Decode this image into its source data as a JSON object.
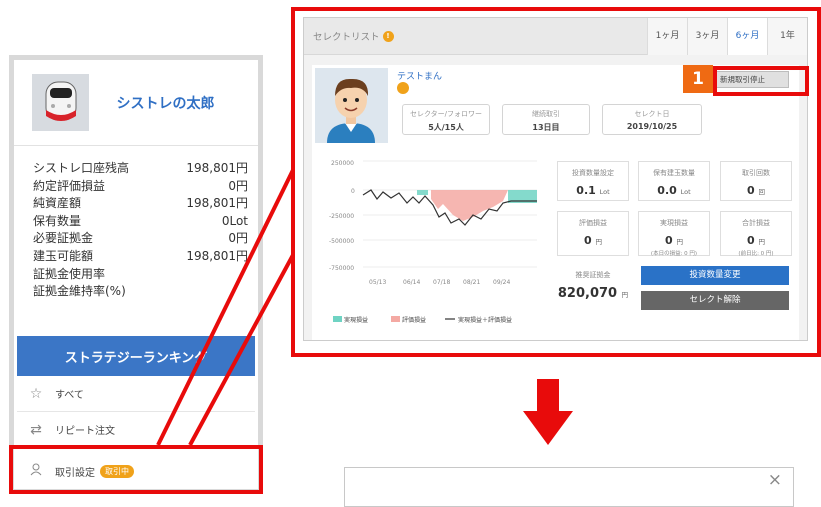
{
  "sidebar": {
    "username": "シストレの太郎",
    "stats": [
      {
        "label": "シストレ口座残高",
        "value": "198,801円"
      },
      {
        "label": "約定評価損益",
        "value": "0円"
      },
      {
        "label": "純資産額",
        "value": "198,801円"
      },
      {
        "label": "保有数量",
        "value": "0Lot"
      },
      {
        "label": "必要証拠金",
        "value": "0円"
      },
      {
        "label": "建玉可能額",
        "value": "198,801円"
      },
      {
        "label": "証拠金使用率",
        "value": ""
      },
      {
        "label": "証拠金維持率(%)",
        "value": ""
      }
    ],
    "ranking_label": "ストラテジーランキング",
    "menu": [
      {
        "label": "すべて",
        "icon": "star-icon"
      },
      {
        "label": "リピート注文",
        "icon": "repeat-icon"
      },
      {
        "label": "取引設定",
        "icon": "user-icon",
        "badge": "取引中"
      }
    ]
  },
  "panel": {
    "title": "セレクトリスト",
    "info_mark": "!",
    "periods": [
      "1ヶ月",
      "3ヶ月",
      "6ヶ月",
      "1年"
    ],
    "active_period": "6ヶ月",
    "trader_name": "テストまん",
    "info_boxes": [
      {
        "label": "セレクター/フォロワー",
        "value": "5人/15人"
      },
      {
        "label": "継続取引",
        "value": "13日目"
      },
      {
        "label": "セレクト日",
        "value": "2019/10/25"
      }
    ],
    "stop_button": "新規取引停止",
    "step_number": "1",
    "metrics": {
      "lot_setting": {
        "label": "投資数量設定",
        "value": "0.1",
        "unit": "Lot"
      },
      "position_qty": {
        "label": "保有建玉数量",
        "value": "0.0",
        "unit": "Lot"
      },
      "trade_count": {
        "label": "取引回数",
        "value": "0",
        "unit": "回"
      },
      "valuation": {
        "label": "評価損益",
        "value": "0",
        "unit": "円"
      },
      "realized": {
        "label": "実現損益",
        "value": "0",
        "unit": "円",
        "sub": "(本日の損益: 0 円)"
      },
      "total": {
        "label": "合計損益",
        "value": "0",
        "unit": "円",
        "sub": "(前日比: 0 円)"
      },
      "recommended_margin": {
        "label": "推奨証拠金",
        "value": "820,070",
        "unit": "円"
      }
    },
    "change_button": "投資数量変更",
    "release_button": "セレクト解除"
  },
  "chart_data": {
    "type": "area",
    "x": [
      "05/13",
      "06/14",
      "07/18",
      "08/21",
      "09/24"
    ],
    "yticks": [
      250000,
      0,
      -250000,
      -500000,
      -750000
    ],
    "ylim": [
      -750000,
      250000
    ],
    "legend": [
      "実現損益",
      "評価損益",
      "実現損益＋評価損益"
    ],
    "colors": {
      "realized": "#6fd3c3",
      "valuation": "#f4a9a3",
      "combined": "#333333"
    }
  },
  "dialog": {
    "close_label": "×"
  }
}
